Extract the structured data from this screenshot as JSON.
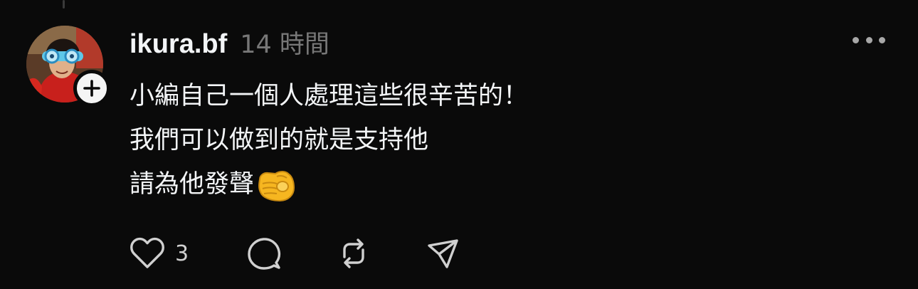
{
  "post": {
    "username": "ikura.bf",
    "timestamp": "14 時間",
    "lines": [
      "小編自己一個人處理這些很辛苦的！",
      "我們可以做到的就是支持他",
      "請為他發聲"
    ],
    "emoji_icon": "backhand-index-pointing-at-viewer-emoji",
    "like_count": "3"
  },
  "icons": {
    "follow": "plus-icon",
    "more": "more-horizontal-icon",
    "like": "heart-icon",
    "reply": "comment-icon",
    "repost": "repost-icon",
    "share": "send-icon"
  },
  "colors": {
    "background": "#0a0a0a",
    "text": "#f3f5f7",
    "muted": "#777777",
    "icon": "#d0d0d0",
    "badge": "#f5f5f5"
  }
}
